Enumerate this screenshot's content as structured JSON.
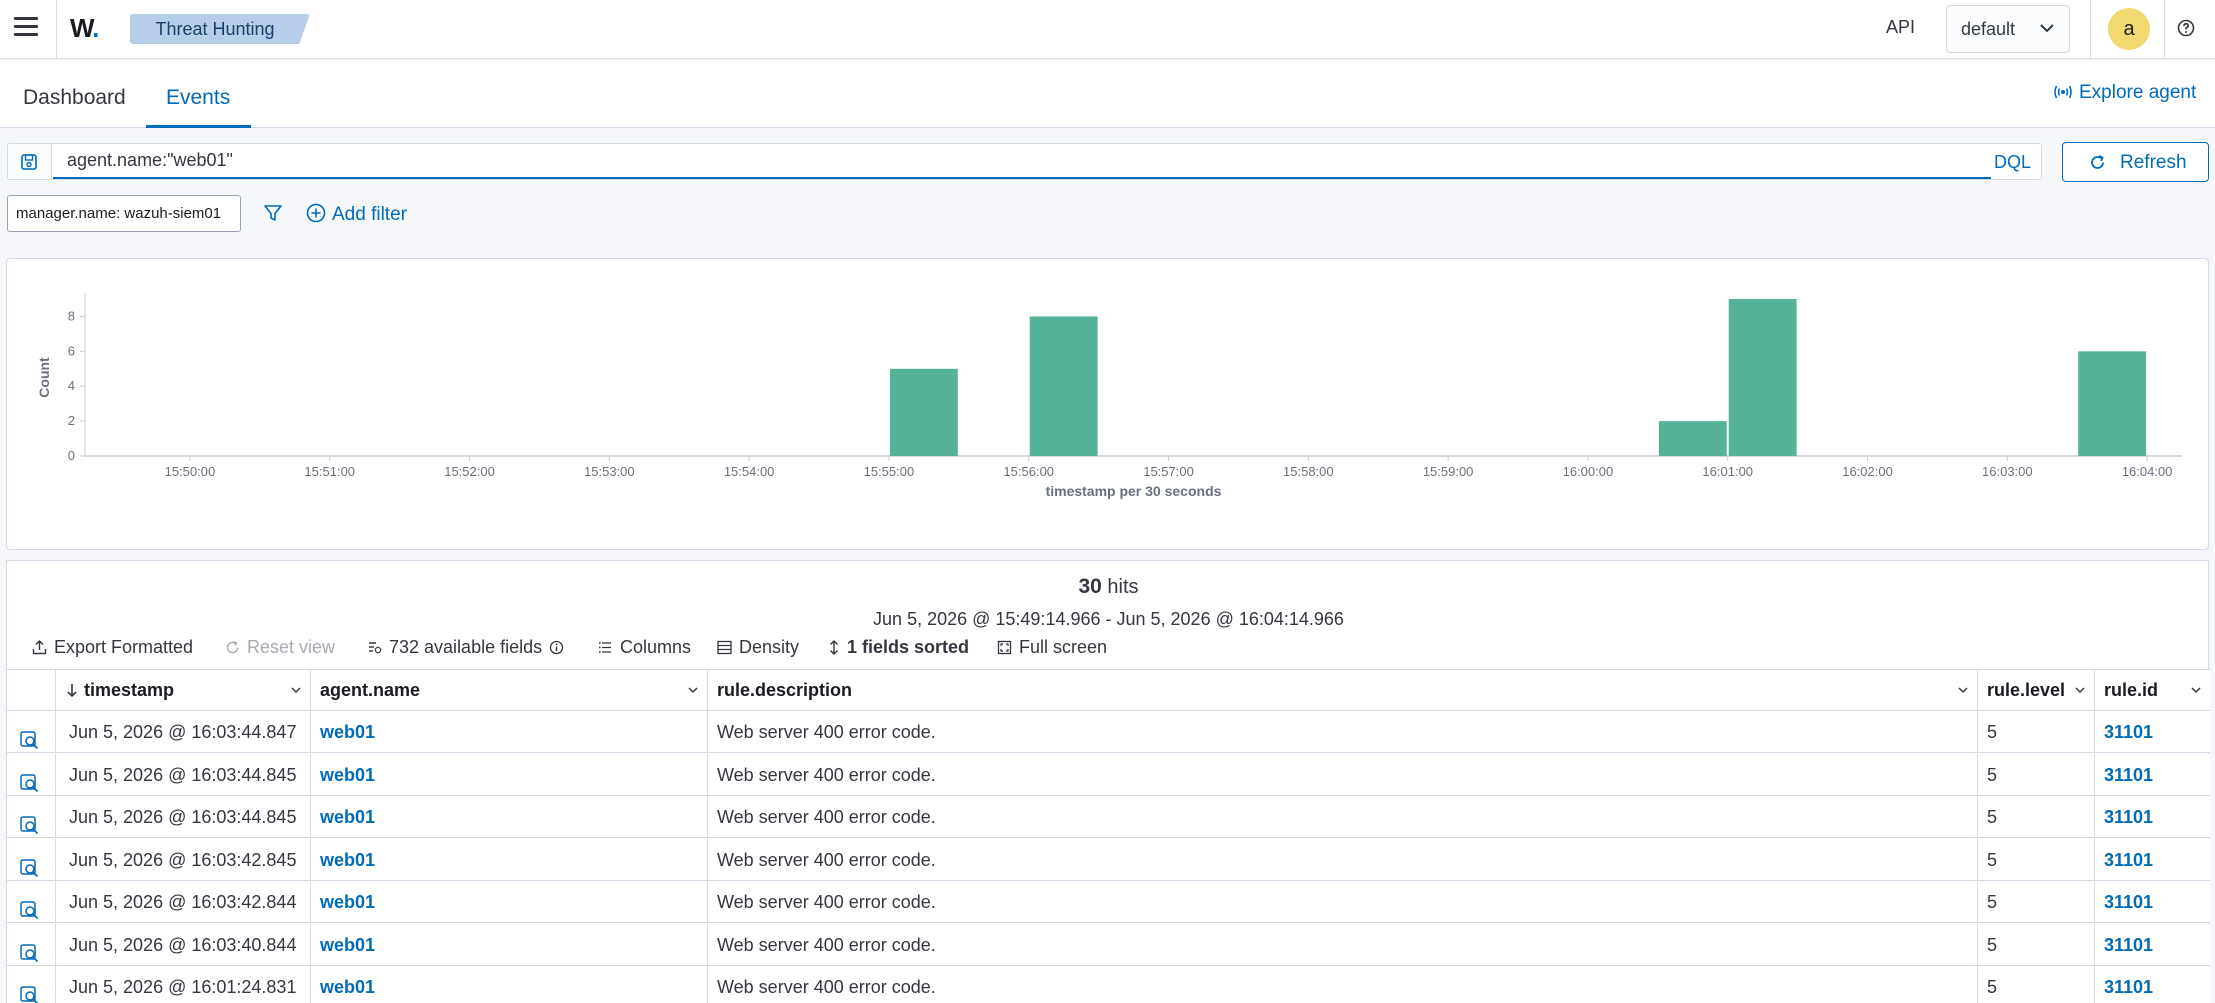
{
  "header": {
    "logo": "W",
    "logo_dot": ".",
    "breadcrumb": "Threat Hunting",
    "api_label": "API",
    "index_select": "default",
    "avatar_initial": "a"
  },
  "tabs": [
    {
      "label": "Dashboard",
      "active": false
    },
    {
      "label": "Events",
      "active": true
    }
  ],
  "explore_agent": "Explore agent",
  "query": {
    "value": "agent.name:\"web01\"",
    "language": "DQL",
    "refresh_label": "Refresh"
  },
  "filters": {
    "pill": "manager.name: wazuh-siem01",
    "add_filter": "Add filter"
  },
  "chart_data": {
    "type": "bar",
    "xlabel": "timestamp per 30 seconds",
    "ylabel": "Count",
    "ylim": [
      0,
      9
    ],
    "y_ticks": [
      0,
      2,
      4,
      6,
      8
    ],
    "x_ticks": [
      "15:50:00",
      "15:51:00",
      "15:52:00",
      "15:53:00",
      "15:54:00",
      "15:55:00",
      "15:56:00",
      "15:57:00",
      "15:58:00",
      "15:59:00",
      "16:00:00",
      "16:01:00",
      "16:02:00",
      "16:03:00",
      "16:04:00"
    ],
    "bars": [
      {
        "start": "15:55:00",
        "value": 5
      },
      {
        "start": "15:56:00",
        "value": 8
      },
      {
        "start": "16:00:30",
        "value": 2
      },
      {
        "start": "16:01:00",
        "value": 9
      },
      {
        "start": "16:03:30",
        "value": 6
      }
    ],
    "color": "#54b399",
    "grid": false
  },
  "results": {
    "hits_count": "30",
    "hits_label": "hits",
    "time_range": "Jun 5, 2026 @ 15:49:14.966 - Jun 5, 2026 @ 16:04:14.966",
    "toolbar": {
      "export": "Export Formatted",
      "reset": "Reset view",
      "fields": "732 available fields",
      "columns": "Columns",
      "density": "Density",
      "sorted": "1 fields sorted",
      "fullscreen": "Full screen"
    },
    "columns": [
      "timestamp",
      "agent.name",
      "rule.description",
      "rule.level",
      "rule.id"
    ],
    "rows": [
      {
        "timestamp": "Jun 5, 2026 @ 16:03:44.847",
        "agent": "web01",
        "description": "Web server 400 error code.",
        "level": "5",
        "id": "31101"
      },
      {
        "timestamp": "Jun 5, 2026 @ 16:03:44.845",
        "agent": "web01",
        "description": "Web server 400 error code.",
        "level": "5",
        "id": "31101"
      },
      {
        "timestamp": "Jun 5, 2026 @ 16:03:44.845",
        "agent": "web01",
        "description": "Web server 400 error code.",
        "level": "5",
        "id": "31101"
      },
      {
        "timestamp": "Jun 5, 2026 @ 16:03:42.845",
        "agent": "web01",
        "description": "Web server 400 error code.",
        "level": "5",
        "id": "31101"
      },
      {
        "timestamp": "Jun 5, 2026 @ 16:03:42.844",
        "agent": "web01",
        "description": "Web server 400 error code.",
        "level": "5",
        "id": "31101"
      },
      {
        "timestamp": "Jun 5, 2026 @ 16:03:40.844",
        "agent": "web01",
        "description": "Web server 400 error code.",
        "level": "5",
        "id": "31101"
      },
      {
        "timestamp": "Jun 5, 2026 @ 16:01:24.831",
        "agent": "web01",
        "description": "Web server 400 error code.",
        "level": "5",
        "id": "31101"
      }
    ]
  }
}
